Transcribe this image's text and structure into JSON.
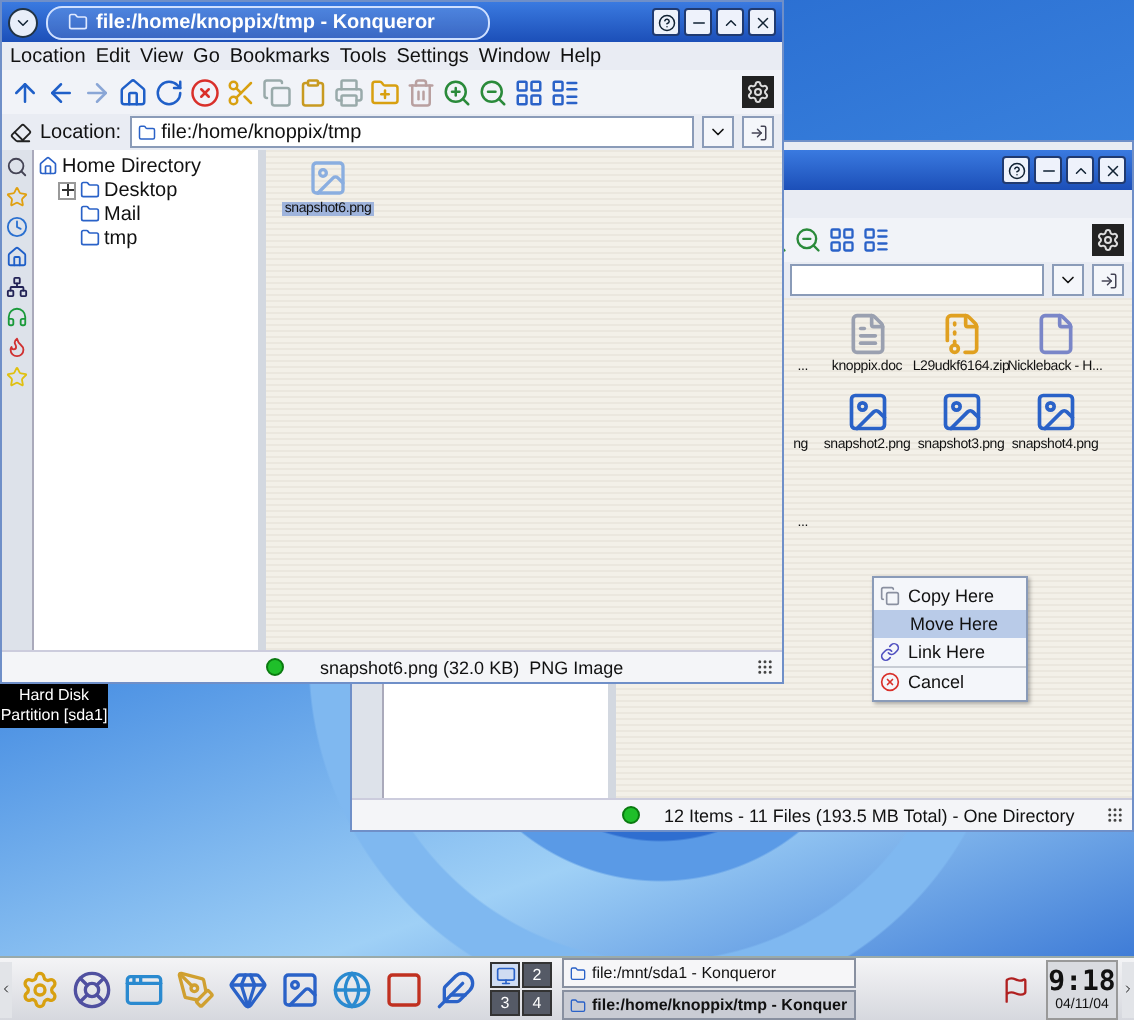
{
  "front_window": {
    "title": "file:/home/knoppix/tmp - Konqueror",
    "menu": [
      "Location",
      "Edit",
      "View",
      "Go",
      "Bookmarks",
      "Tools",
      "Settings",
      "Window",
      "Help"
    ],
    "location_label": "Location:",
    "location": "file:/home/knoppix/tmp",
    "tree": [
      {
        "label": "Home Directory",
        "children": [
          {
            "label": "Desktop",
            "expanded": false
          },
          {
            "label": "Mail"
          },
          {
            "label": "tmp"
          }
        ]
      }
    ],
    "files": [
      {
        "name": "snapshot6.png",
        "selected": true
      }
    ],
    "status": "snapshot6.png (32.0 KB)  PNG Image"
  },
  "back_window": {
    "files": [
      {
        "name": "...",
        "kind": "hidden"
      },
      {
        "name": "knoppix.doc",
        "kind": "doc"
      },
      {
        "name": "L29udkf6164.zip",
        "kind": "zip"
      },
      {
        "name": "Nickleback - H...",
        "kind": "file"
      },
      {
        "name": "ng",
        "kind": "hidden"
      },
      {
        "name": "snapshot2.png",
        "kind": "image"
      },
      {
        "name": "snapshot3.png",
        "kind": "image"
      },
      {
        "name": "snapshot4.png",
        "kind": "image"
      },
      {
        "name": "...",
        "kind": "hidden"
      }
    ],
    "status": "12 Items - 11 Files (193.5 MB Total) - One Directory"
  },
  "context_menu": [
    {
      "label": "Copy Here",
      "kind": "copy",
      "selected": false
    },
    {
      "label": "Move Here",
      "kind": "move",
      "selected": true
    },
    {
      "label": "Link Here",
      "kind": "link",
      "selected": false
    },
    {
      "label": "Cancel",
      "kind": "cancel",
      "selected": false
    }
  ],
  "desktop_icon_label": "Hard Disk Partition [sda1]",
  "taskbar": {
    "pager": [
      {
        "selected": true
      },
      {
        "label": "2",
        "selected": false
      },
      {
        "label": "3",
        "selected": false
      },
      {
        "label": "4",
        "selected": false
      }
    ],
    "tasks": [
      {
        "title": "file:/mnt/sda1 - Konqueror",
        "selected": false
      },
      {
        "title": "file:/home/knoppix/tmp - Konquer",
        "selected": true
      }
    ],
    "time": "9:18",
    "date": "04/11/04"
  }
}
